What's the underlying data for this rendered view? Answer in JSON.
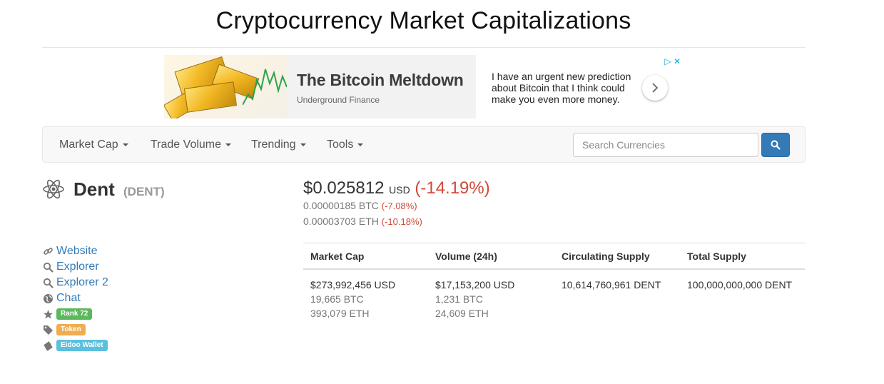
{
  "header": {
    "title": "Cryptocurrency Market Capitalizations"
  },
  "ad": {
    "brand": "The Bitcoin Meltdown",
    "subtitle": "Underground Finance",
    "text": "I have an urgent new prediction about Bitcoin that I think could make you even more money.",
    "choices": "▷ ✕"
  },
  "nav": {
    "items": [
      {
        "label": "Market Cap"
      },
      {
        "label": "Trade Volume"
      },
      {
        "label": "Trending"
      },
      {
        "label": "Tools"
      }
    ],
    "search_placeholder": "Search Currencies",
    "accent": "#337ab7"
  },
  "coin": {
    "name": "Dent",
    "symbol": "(DENT)",
    "price_usd": "$0.025812",
    "currency": "USD",
    "change_usd": "(-14.19%)",
    "price_btc": "0.00000185 BTC",
    "change_btc": "(-7.08%)",
    "price_eth": "0.00003703 ETH",
    "change_eth": "(-10.18%)",
    "negative_color": "#d14836"
  },
  "links": {
    "website": "Website",
    "explorer": "Explorer",
    "explorer2": "Explorer 2",
    "chat": "Chat",
    "rank": "Rank 72",
    "token": "Token",
    "wallet": "Eidoo Wallet"
  },
  "stats": {
    "headers": [
      "Market Cap",
      "Volume (24h)",
      "Circulating Supply",
      "Total Supply"
    ],
    "market_cap": {
      "usd": "$273,992,456 USD",
      "btc": "19,665 BTC",
      "eth": "393,079 ETH"
    },
    "volume": {
      "usd": "$17,153,200 USD",
      "btc": "1,231 BTC",
      "eth": "24,609 ETH"
    },
    "circulating_supply": "10,614,760,961 DENT",
    "total_supply": "100,000,000,000 DENT"
  }
}
